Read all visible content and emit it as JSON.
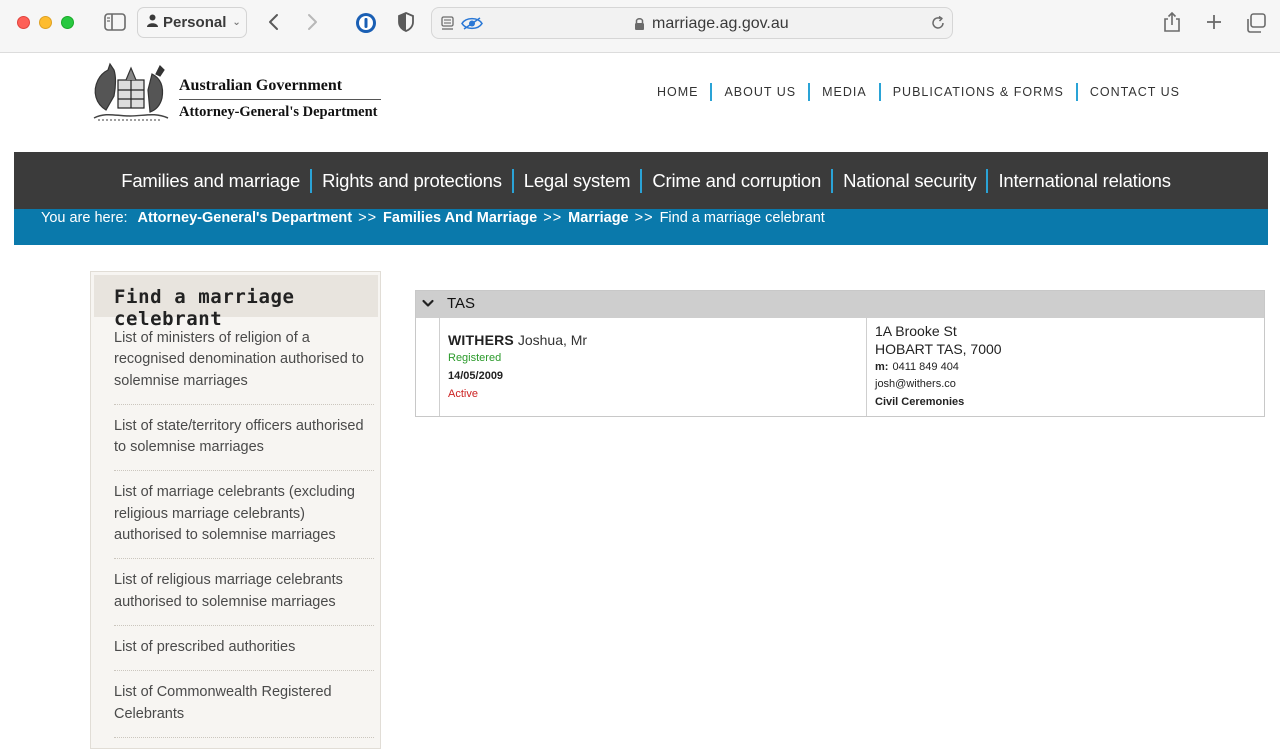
{
  "browser": {
    "profile_label": "Personal",
    "url": "marriage.ag.gov.au"
  },
  "site": {
    "brand_line1": "Australian Government",
    "brand_line2": "Attorney-General's Department"
  },
  "top_nav": [
    "HOME",
    "ABOUT US",
    "MEDIA",
    "PUBLICATIONS & FORMS",
    "CONTACT US"
  ],
  "main_nav": [
    "Families and marriage",
    "Rights and protections",
    "Legal system",
    "Crime and corruption",
    "National security",
    "International relations"
  ],
  "breadcrumb": {
    "label": "You are here:",
    "separator": ">>",
    "items": [
      "Attorney-General's Department",
      "Families And Marriage",
      "Marriage"
    ],
    "current": "Find a marriage celebrant"
  },
  "side_menu": {
    "heading": "Find a marriage celebrant",
    "items": [
      "List of ministers of religion of a recognised denomination authorised to solemnise marriages",
      "List of state/territory officers authorised to solemnise marriages",
      "List of marriage celebrants (excluding religious marriage celebrants) authorised to solemnise marriages",
      "List of religious marriage celebrants authorised to solemnise marriages",
      "List of prescribed authorities",
      "List of Commonwealth Registered Celebrants"
    ]
  },
  "results": {
    "state": "TAS",
    "celebrant": {
      "surname": "WITHERS",
      "given": "Joshua, Mr",
      "registration": "Registered",
      "date": "14/05/2009",
      "status": "Active",
      "address_line1": "1A Brooke St",
      "address_line2": "HOBART TAS, 7000",
      "phone_prefix": "m:",
      "phone": "0411 849 404",
      "email": "josh@withers.co",
      "service": "Civil Ceremonies"
    }
  },
  "colors": {
    "accent_blue": "#2aa3d6",
    "nav_dark": "#3b3b3b",
    "breadcrumb_blue": "#0a79ab",
    "registered_green": "#2a9a2a",
    "active_red": "#cc2222"
  }
}
